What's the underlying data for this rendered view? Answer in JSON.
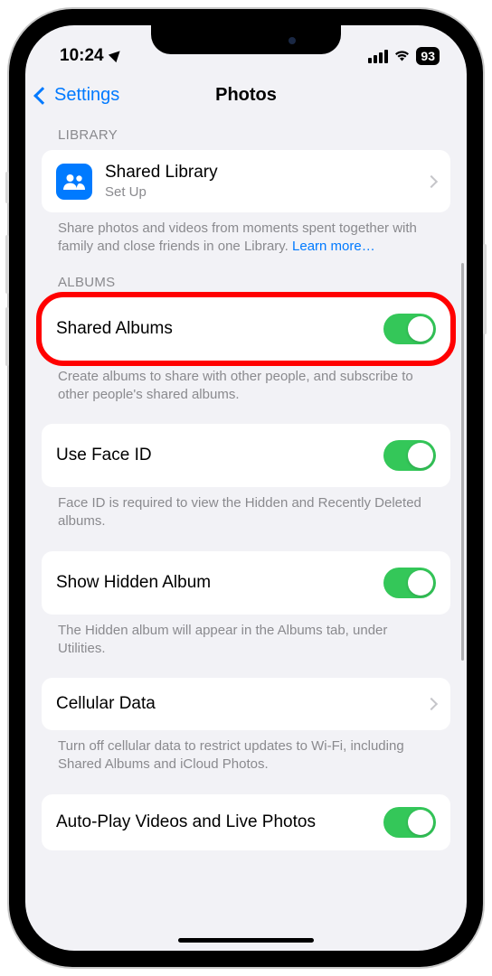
{
  "statusBar": {
    "time": "10:24",
    "battery": "93"
  },
  "nav": {
    "back": "Settings",
    "title": "Photos"
  },
  "sections": {
    "library": {
      "header": "LIBRARY",
      "item": {
        "title": "Shared Library",
        "subtitle": "Set Up"
      },
      "footer": "Share photos and videos from moments spent together with family and close friends in one Library. ",
      "learnMore": "Learn more…"
    },
    "albums": {
      "header": "ALBUMS",
      "sharedAlbums": {
        "title": "Shared Albums"
      },
      "sharedAlbumsFooter": "Create albums to share with other people, and subscribe to other people's shared albums.",
      "useFaceId": {
        "title": "Use Face ID"
      },
      "useFaceIdFooter": "Face ID is required to view the Hidden and Recently Deleted albums.",
      "showHidden": {
        "title": "Show Hidden Album"
      },
      "showHiddenFooter": "The Hidden album will appear in the Albums tab, under Utilities.",
      "cellular": {
        "title": "Cellular Data"
      },
      "cellularFooter": "Turn off cellular data to restrict updates to Wi-Fi, including Shared Albums and iCloud Photos.",
      "autoplay": {
        "title": "Auto-Play Videos and Live Photos"
      }
    }
  }
}
